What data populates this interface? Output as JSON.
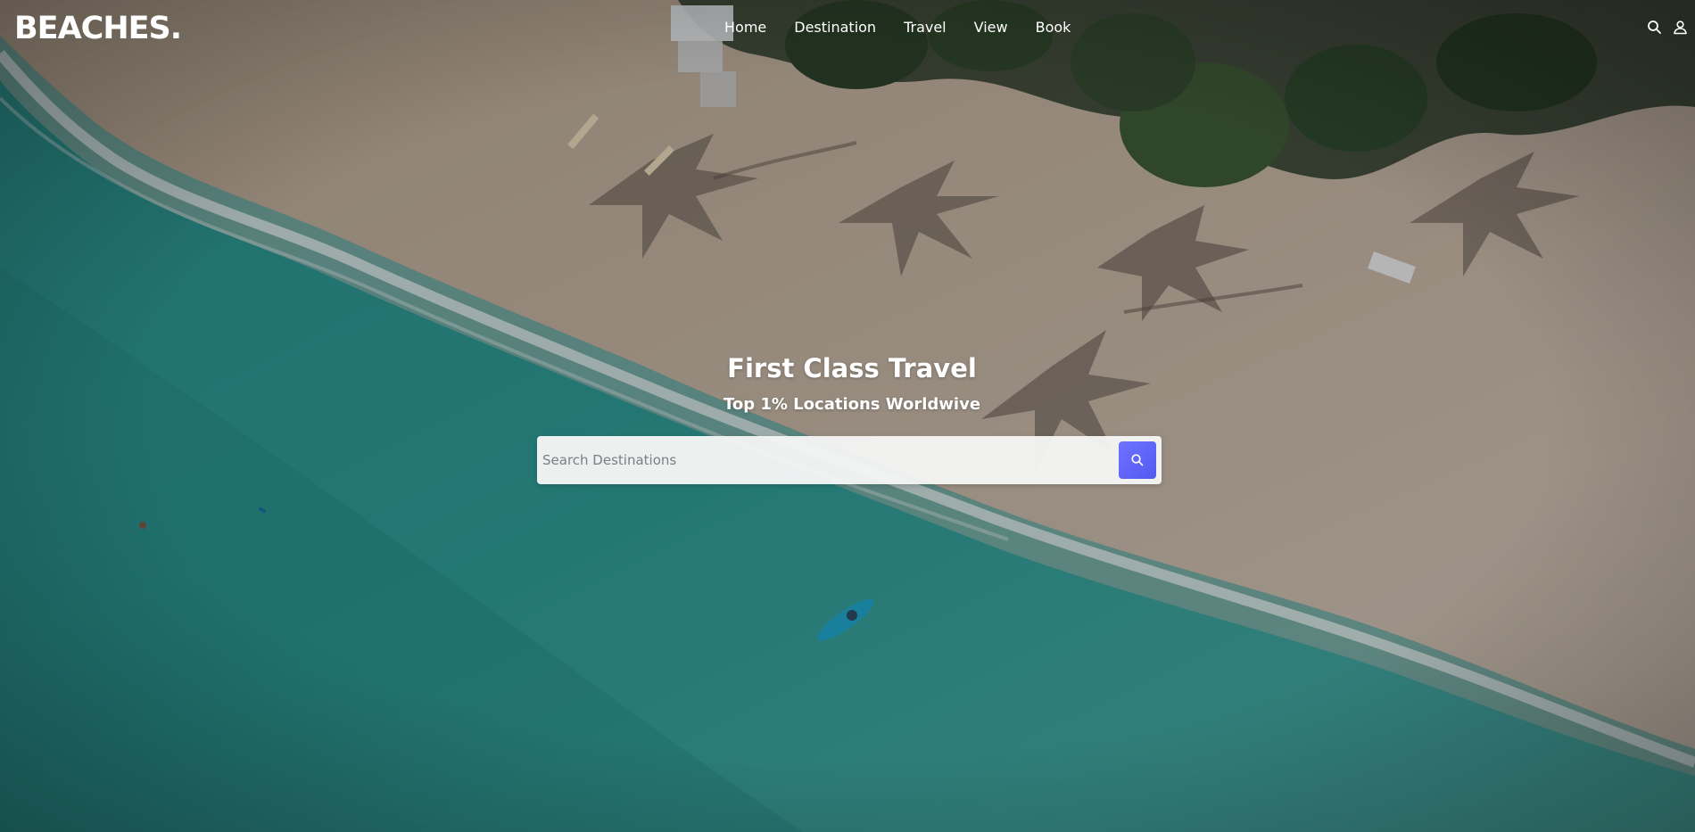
{
  "brand": {
    "logo_text": "BEACHES."
  },
  "nav": {
    "items": [
      {
        "label": "Home"
      },
      {
        "label": "Destination"
      },
      {
        "label": "Travel"
      },
      {
        "label": "View"
      },
      {
        "label": "Book"
      }
    ],
    "icons": [
      "search-icon",
      "user-icon"
    ]
  },
  "hero": {
    "title": "First Class Travel",
    "subtitle": "Top 1% Locations Worldwive",
    "search": {
      "placeholder": "Search Destinations",
      "value": "",
      "button_icon": "search-icon"
    }
  },
  "colors": {
    "accent": "#5c60f5",
    "text": "#ffffff",
    "search_bg": "#f5f5f5"
  }
}
